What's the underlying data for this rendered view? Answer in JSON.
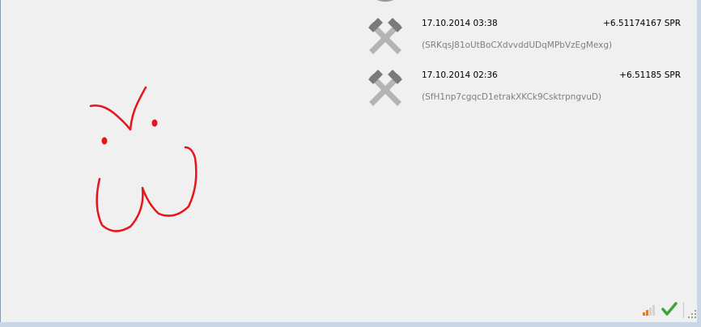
{
  "transactions": [
    {
      "date": "17.10.2014 03:38",
      "amount": "+6.51174167 SPR",
      "address": "(SRKqsJ81oUtBoCXdvvddUDqMPbVzEgMexg)",
      "icon": "mined-pickaxe-icon"
    },
    {
      "date": "17.10.2014 02:36",
      "amount": "+6.51185 SPR",
      "address": "(SfH1np7cgqcD1etrakXKCk9CsktrpngvuD)",
      "icon": "mined-pickaxe-icon"
    }
  ],
  "status": {
    "network_icon": "network-signal-icon",
    "sync_icon": "synced-check-icon",
    "grip_icon": "resize-grip-icon"
  },
  "colors": {
    "background": "#f0f0f0",
    "drawing": "#e8141b",
    "address_text": "#7f7f7f",
    "pickaxe_dark": "#7a7a7a",
    "pickaxe_light": "#b4b4b4",
    "check": "#3aa53a"
  }
}
